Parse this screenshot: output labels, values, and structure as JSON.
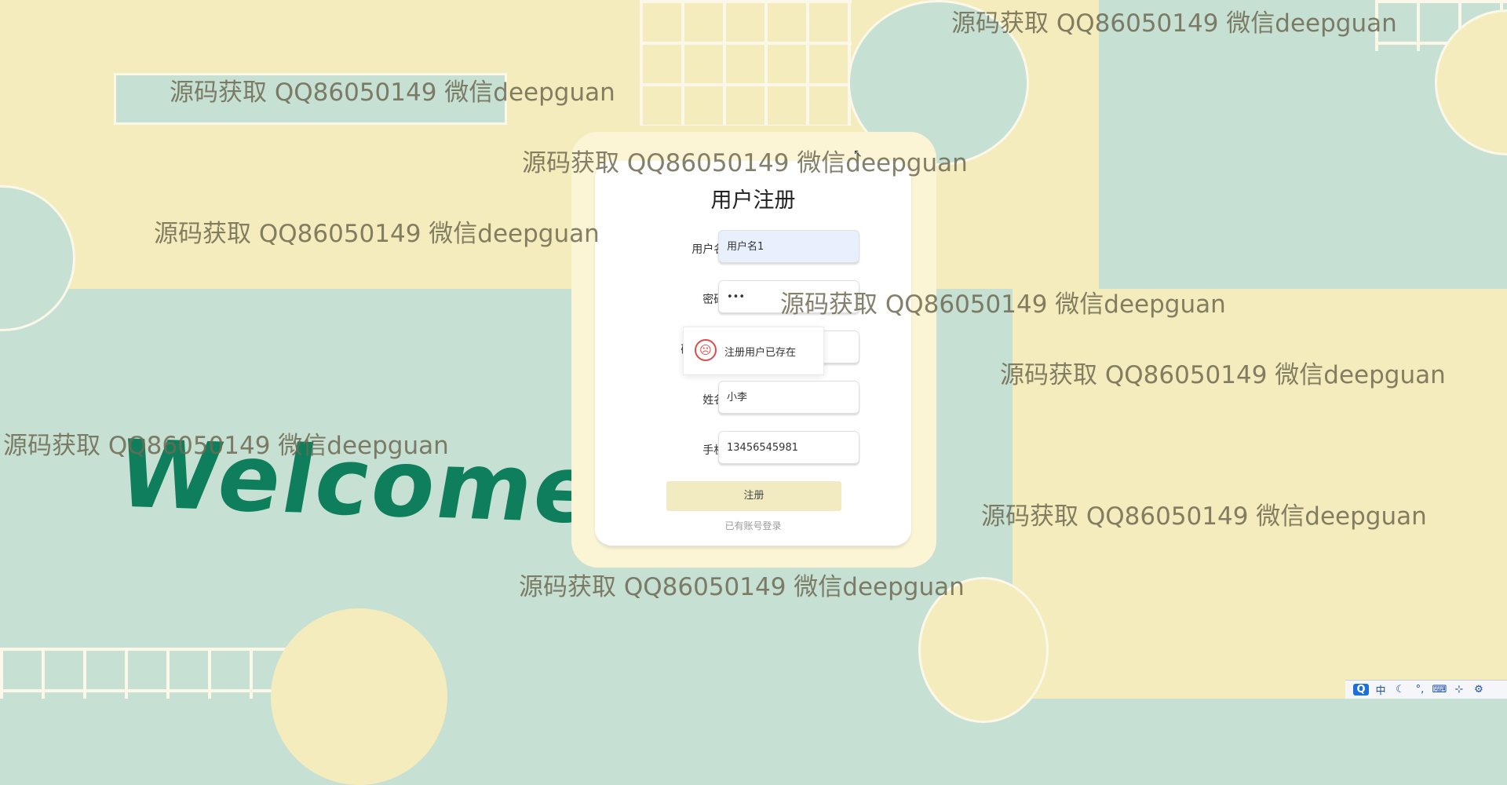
{
  "background": {
    "welcome_text": "Welcome",
    "watermark_text": "源码获取 QQ86050149 微信deepguan"
  },
  "form": {
    "title": "用户注册",
    "username_label": "用户名:",
    "username_value": "用户名1",
    "password_label": "密码:",
    "password_value": "•••",
    "confirm_label": "确认密码:",
    "name_label": "姓名:",
    "name_value": "小李",
    "phone_label": "手机:",
    "phone_value": "13456545981",
    "submit_label": "注册",
    "login_link": "已有账号登录"
  },
  "toast": {
    "icon": "sad-face-icon",
    "message": "注册用户已存在"
  },
  "tray": {
    "items": [
      "Q",
      "中",
      "☾",
      "°,",
      "⌨",
      "⊹",
      "⚙"
    ]
  },
  "colors": {
    "mint": "#c6e0d3",
    "cream": "#f4ecbd",
    "welcome_green": "#0f7e5c",
    "button": "#f2ebc1"
  }
}
